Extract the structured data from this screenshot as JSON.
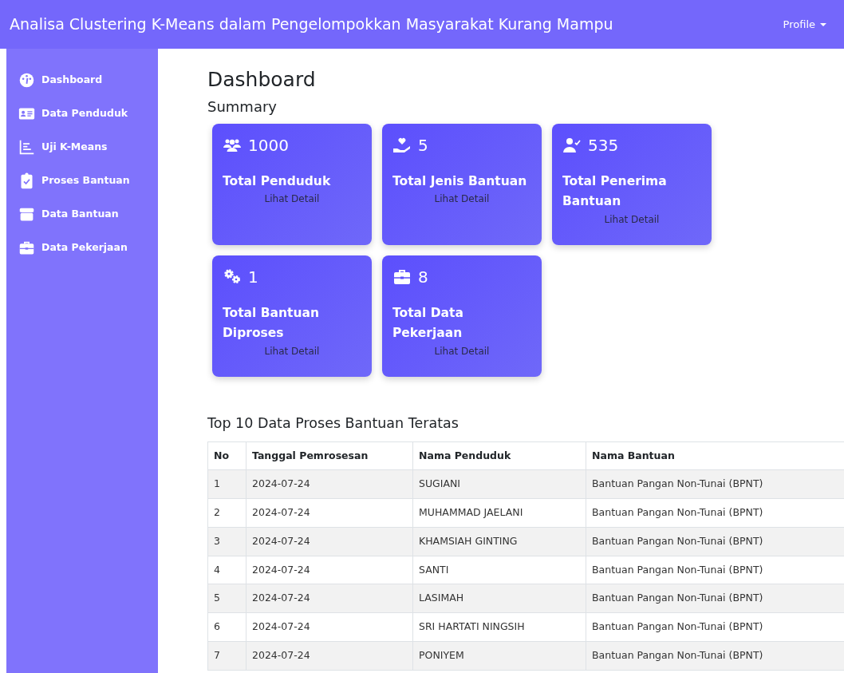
{
  "navbar": {
    "title": "Analisa Clustering K-Means dalam Pengelompokkan Masyarakat Kurang Mampu",
    "profile": "Profile"
  },
  "sidebar": {
    "items": [
      {
        "label": "Dashboard",
        "kind": "gauge"
      },
      {
        "label": "Data Penduduk",
        "kind": "idcard"
      },
      {
        "label": "Uji K-Means",
        "kind": "chart"
      },
      {
        "label": "Proses Bantuan",
        "kind": "clipboard"
      },
      {
        "label": "Data Bantuan",
        "kind": "box"
      },
      {
        "label": "Data Pekerjaan",
        "kind": "briefcase"
      }
    ]
  },
  "heading": "Dashboard",
  "summary": {
    "title": "Summary",
    "cards": [
      {
        "kind": "users",
        "value": "1000",
        "label": "Total Penduduk",
        "link": "Lihat Detail"
      },
      {
        "kind": "hand",
        "value": "5",
        "label": "Total Jenis Bantuan",
        "link": "Lihat Detail"
      },
      {
        "kind": "usercheck",
        "value": "535",
        "label": "Total Penerima Bantuan",
        "link": "Lihat Detail"
      },
      {
        "kind": "gears",
        "value": "1",
        "label": "Total Bantuan Diproses",
        "link": "Lihat Detail"
      },
      {
        "kind": "briefcase",
        "value": "8",
        "label": "Total Data Pekerjaan",
        "link": "Lihat Detail"
      }
    ]
  },
  "table": {
    "title": "Top 10 Data Proses Bantuan Teratas",
    "columns": [
      "No",
      "Tanggal Pemrosesan",
      "Nama Penduduk",
      "Nama Bantuan"
    ],
    "rows": [
      [
        "1",
        "2024-07-24",
        "SUGIANI",
        "Bantuan Pangan Non-Tunai (BPNT)"
      ],
      [
        "2",
        "2024-07-24",
        "MUHAMMAD JAELANI",
        "Bantuan Pangan Non-Tunai (BPNT)"
      ],
      [
        "3",
        "2024-07-24",
        "KHAMSIAH GINTING",
        "Bantuan Pangan Non-Tunai (BPNT)"
      ],
      [
        "4",
        "2024-07-24",
        "SANTI",
        "Bantuan Pangan Non-Tunai (BPNT)"
      ],
      [
        "5",
        "2024-07-24",
        "LASIMAH",
        "Bantuan Pangan Non-Tunai (BPNT)"
      ],
      [
        "6",
        "2024-07-24",
        "SRI HARTATI NINGSIH",
        "Bantuan Pangan Non-Tunai (BPNT)"
      ],
      [
        "7",
        "2024-07-24",
        "PONIYEM",
        "Bantuan Pangan Non-Tunai (BPNT)"
      ]
    ]
  }
}
